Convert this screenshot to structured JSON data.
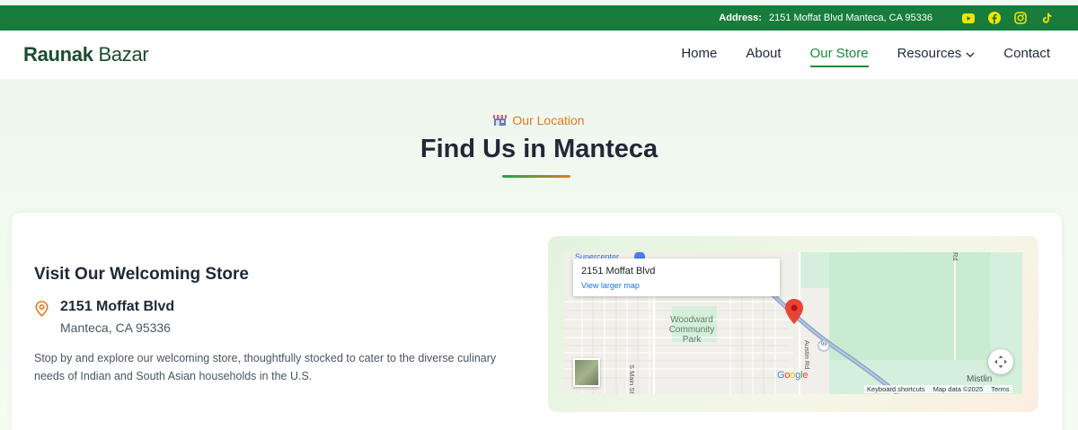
{
  "topbar": {
    "address_label": "Address:",
    "address_value": "2151 Moffat Blvd Manteca, CA 95336",
    "social": [
      "youtube-icon",
      "facebook-icon",
      "instagram-icon",
      "tiktok-icon"
    ],
    "background": "#177c3c",
    "icon_color": "#f4e300"
  },
  "header": {
    "logo_bold": "Raunak",
    "logo_rest": " Bazar",
    "nav": [
      {
        "label": "Home"
      },
      {
        "label": "About"
      },
      {
        "label": "Our Store",
        "active": true
      },
      {
        "label": "Resources",
        "dropdown": true
      },
      {
        "label": "Contact"
      }
    ],
    "accent": "#1a8a3c"
  },
  "section": {
    "eyebrow": "Our Location",
    "title": "Find Us in Manteca",
    "eyebrow_color": "#e07a1f"
  },
  "store": {
    "heading": "Visit Our Welcoming Store",
    "street": "2151 Moffat Blvd",
    "city": "Manteca, CA 95336",
    "description": "Stop by and explore our welcoming store, thoughtfully stocked to cater to the diverse culinary needs of Indian and South Asian households in the U.S."
  },
  "map": {
    "info_title": "2151 Moffat Blvd",
    "info_link": "View larger map",
    "park_label": "Woodward Community Park",
    "street_1": "S Main St",
    "street_2": "Austin Rd",
    "street_3": "Rd",
    "place_top": "Supercenter",
    "place_right": "Mistlin",
    "highway": "99",
    "google": "Google",
    "attrib_keyboard": "Keyboard shortcuts",
    "attrib_data": "Map data ©2025",
    "attrib_terms": "Terms"
  }
}
